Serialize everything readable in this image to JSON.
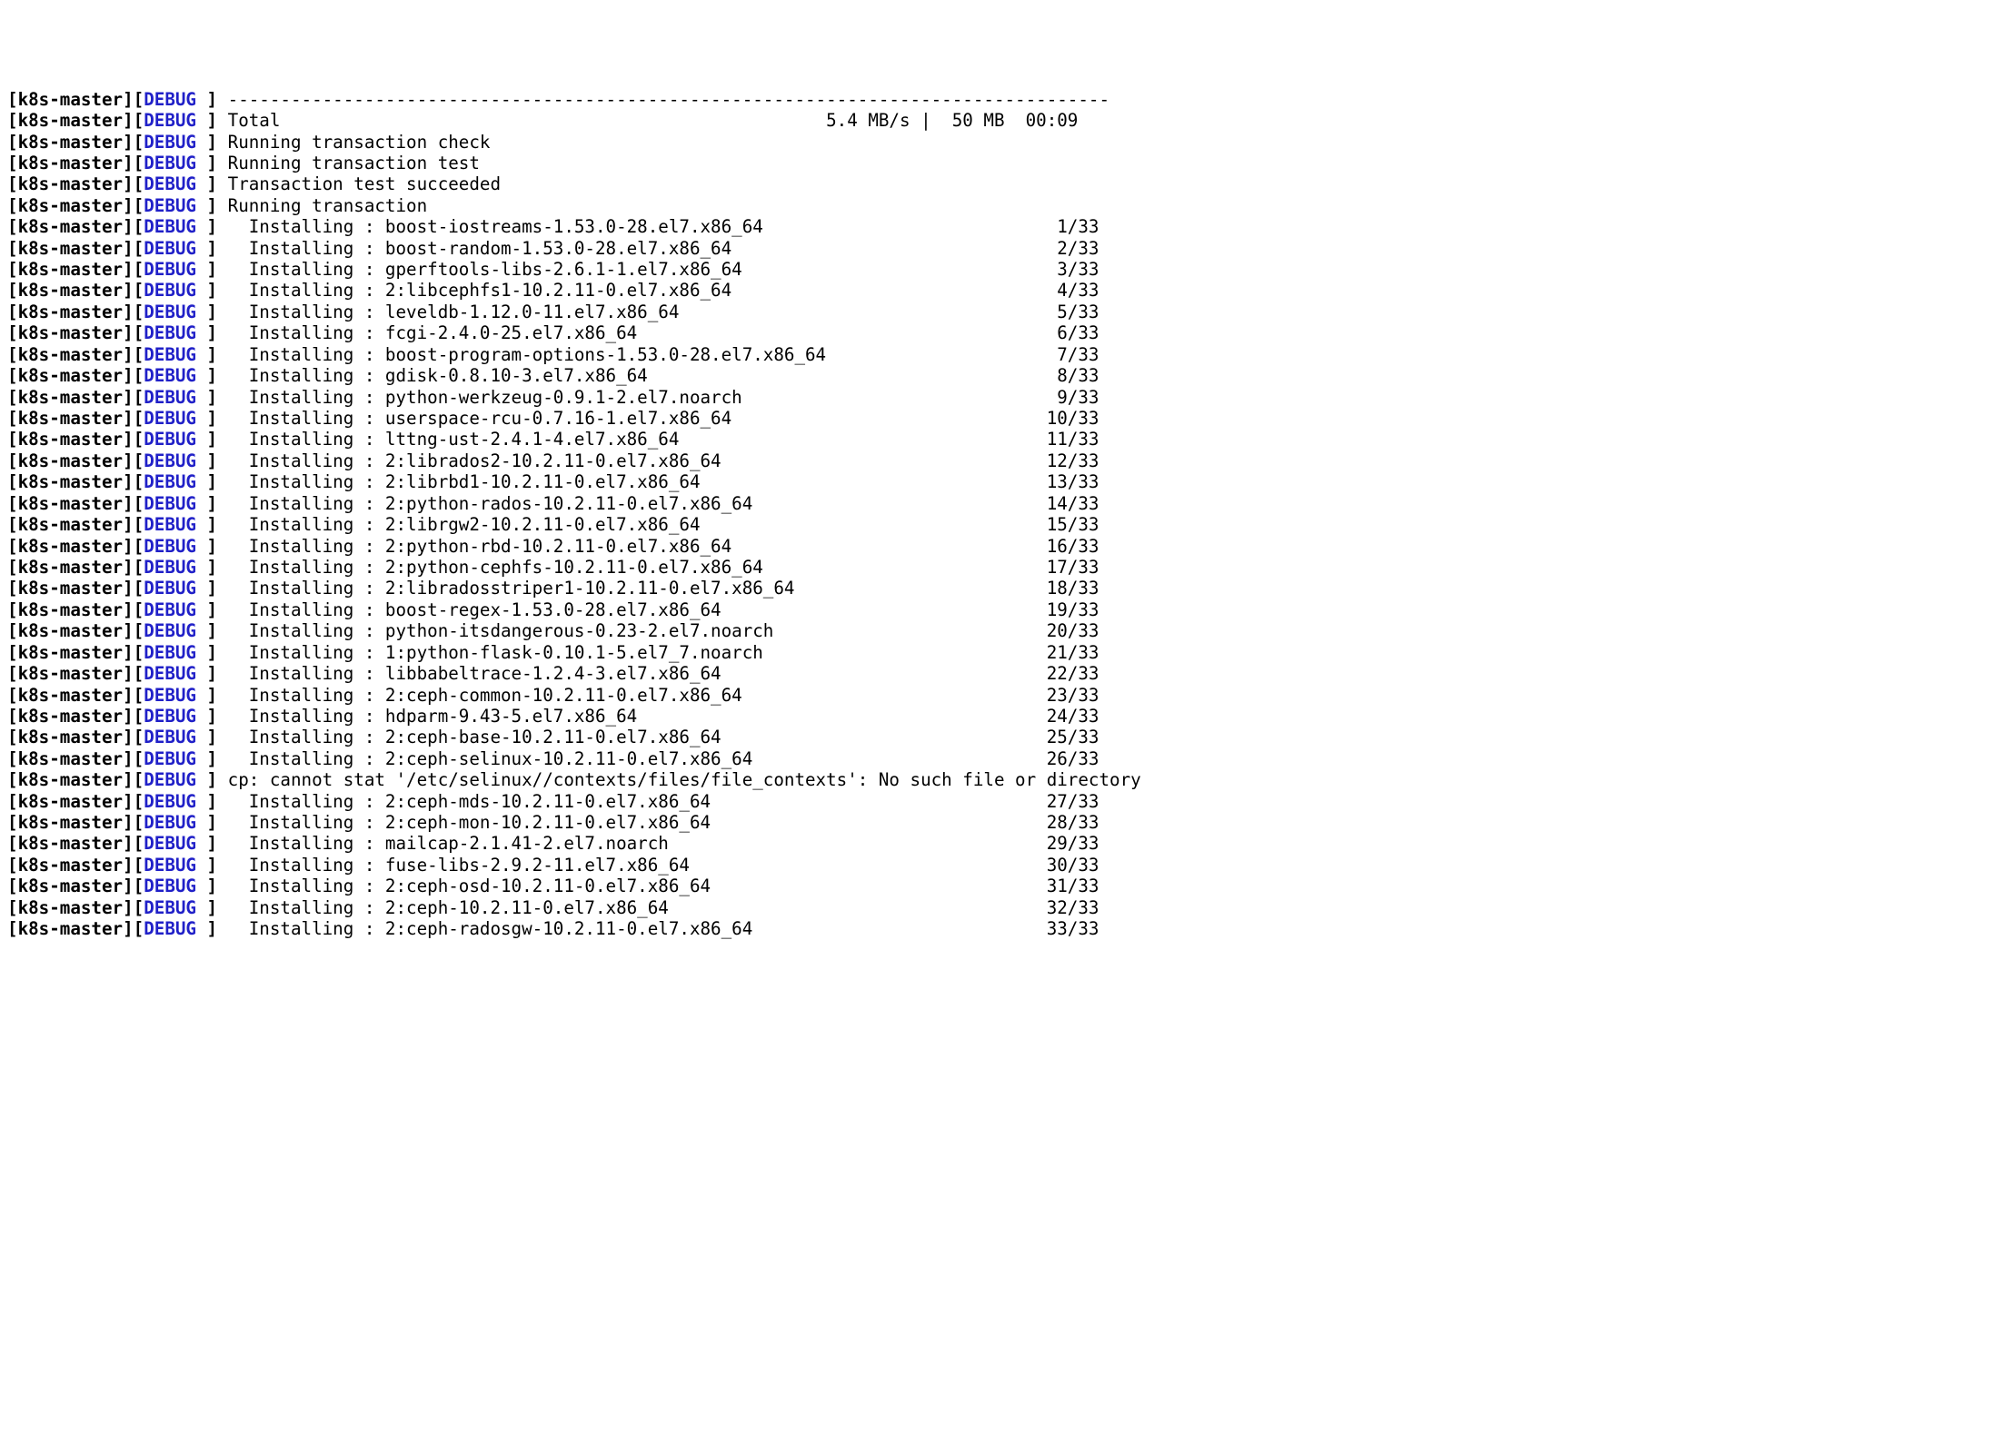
{
  "host": "k8s-master",
  "level": "DEBUG",
  "divider": "------------------------------------------------------------------------------------",
  "total_label": "Total",
  "total_speed": "5.4 MB/s",
  "total_size": "50 MB",
  "total_time": "00:09",
  "status_lines": [
    "Running transaction check",
    "Running transaction test",
    "Transaction test succeeded",
    "Running transaction"
  ],
  "install_label": "Installing",
  "installs_a": [
    {
      "pkg": "boost-iostreams-1.53.0-28.el7.x86_64",
      "n": "1/33"
    },
    {
      "pkg": "boost-random-1.53.0-28.el7.x86_64",
      "n": "2/33"
    },
    {
      "pkg": "gperftools-libs-2.6.1-1.el7.x86_64",
      "n": "3/33"
    },
    {
      "pkg": "2:libcephfs1-10.2.11-0.el7.x86_64",
      "n": "4/33"
    },
    {
      "pkg": "leveldb-1.12.0-11.el7.x86_64",
      "n": "5/33"
    },
    {
      "pkg": "fcgi-2.4.0-25.el7.x86_64",
      "n": "6/33"
    },
    {
      "pkg": "boost-program-options-1.53.0-28.el7.x86_64",
      "n": "7/33"
    },
    {
      "pkg": "gdisk-0.8.10-3.el7.x86_64",
      "n": "8/33"
    },
    {
      "pkg": "python-werkzeug-0.9.1-2.el7.noarch",
      "n": "9/33"
    },
    {
      "pkg": "userspace-rcu-0.7.16-1.el7.x86_64",
      "n": "10/33"
    },
    {
      "pkg": "lttng-ust-2.4.1-4.el7.x86_64",
      "n": "11/33"
    },
    {
      "pkg": "2:librados2-10.2.11-0.el7.x86_64",
      "n": "12/33"
    },
    {
      "pkg": "2:librbd1-10.2.11-0.el7.x86_64",
      "n": "13/33"
    },
    {
      "pkg": "2:python-rados-10.2.11-0.el7.x86_64",
      "n": "14/33"
    },
    {
      "pkg": "2:librgw2-10.2.11-0.el7.x86_64",
      "n": "15/33"
    },
    {
      "pkg": "2:python-rbd-10.2.11-0.el7.x86_64",
      "n": "16/33"
    },
    {
      "pkg": "2:python-cephfs-10.2.11-0.el7.x86_64",
      "n": "17/33"
    },
    {
      "pkg": "2:libradosstriper1-10.2.11-0.el7.x86_64",
      "n": "18/33"
    },
    {
      "pkg": "boost-regex-1.53.0-28.el7.x86_64",
      "n": "19/33"
    },
    {
      "pkg": "python-itsdangerous-0.23-2.el7.noarch",
      "n": "20/33"
    },
    {
      "pkg": "1:python-flask-0.10.1-5.el7_7.noarch",
      "n": "21/33"
    },
    {
      "pkg": "libbabeltrace-1.2.4-3.el7.x86_64",
      "n": "22/33"
    },
    {
      "pkg": "2:ceph-common-10.2.11-0.el7.x86_64",
      "n": "23/33"
    },
    {
      "pkg": "hdparm-9.43-5.el7.x86_64",
      "n": "24/33"
    },
    {
      "pkg": "2:ceph-base-10.2.11-0.el7.x86_64",
      "n": "25/33"
    },
    {
      "pkg": "2:ceph-selinux-10.2.11-0.el7.x86_64",
      "n": "26/33"
    }
  ],
  "cp_error": "cp: cannot stat '/etc/selinux//contexts/files/file_contexts': No such file or directory",
  "installs_b": [
    {
      "pkg": "2:ceph-mds-10.2.11-0.el7.x86_64",
      "n": "27/33"
    },
    {
      "pkg": "2:ceph-mon-10.2.11-0.el7.x86_64",
      "n": "28/33"
    },
    {
      "pkg": "mailcap-2.1.41-2.el7.noarch",
      "n": "29/33"
    },
    {
      "pkg": "fuse-libs-2.9.2-11.el7.x86_64",
      "n": "30/33"
    },
    {
      "pkg": "2:ceph-osd-10.2.11-0.el7.x86_64",
      "n": "31/33"
    },
    {
      "pkg": "2:ceph-10.2.11-0.el7.x86_64",
      "n": "32/33"
    },
    {
      "pkg": "2:ceph-radosgw-10.2.11-0.el7.x86_64",
      "n": "33/33"
    }
  ]
}
